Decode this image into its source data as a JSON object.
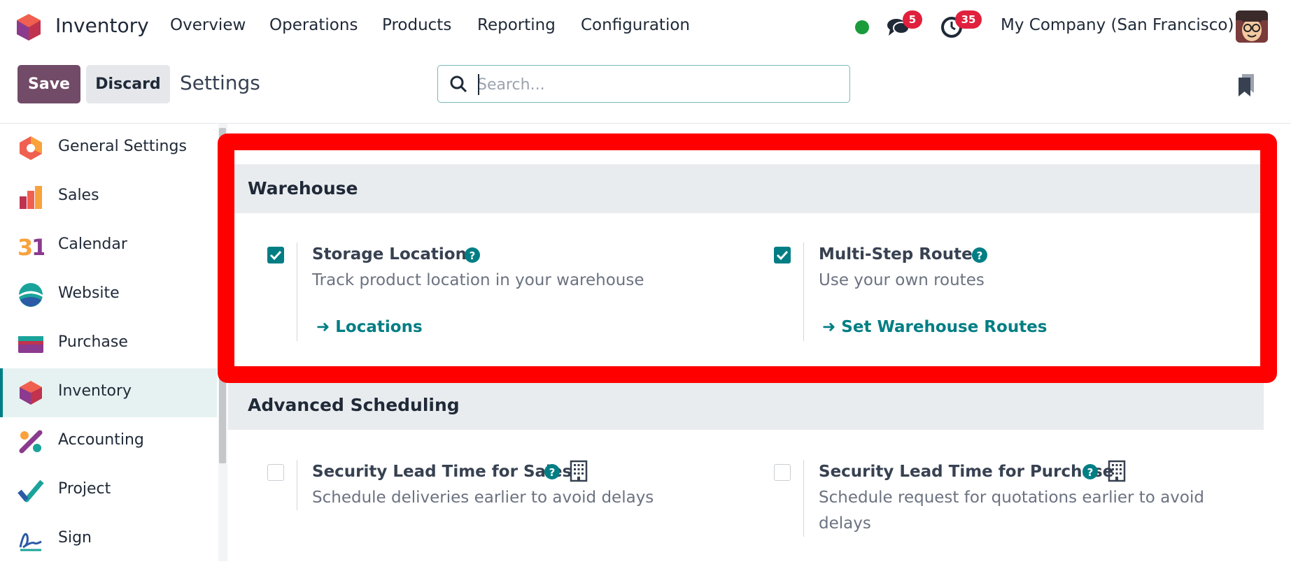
{
  "app": {
    "name": "Inventory",
    "menu": [
      "Overview",
      "Operations",
      "Products",
      "Reporting",
      "Configuration"
    ],
    "messages_count": "5",
    "activities_count": "35",
    "company": "My Company (San Francisco)",
    "presence_color": "#1a9c3c"
  },
  "control": {
    "save_label": "Save",
    "discard_label": "Discard",
    "breadcrumb": "Settings",
    "search_placeholder": "Search...",
    "search_value": ""
  },
  "sidebar": {
    "items": [
      {
        "label": "General Settings",
        "icon": "general-settings-icon"
      },
      {
        "label": "Sales",
        "icon": "sales-icon"
      },
      {
        "label": "Calendar",
        "icon": "calendar-icon"
      },
      {
        "label": "Website",
        "icon": "website-icon"
      },
      {
        "label": "Purchase",
        "icon": "purchase-icon"
      },
      {
        "label": "Inventory",
        "icon": "inventory-icon",
        "active": true
      },
      {
        "label": "Accounting",
        "icon": "accounting-icon"
      },
      {
        "label": "Project",
        "icon": "project-icon"
      },
      {
        "label": "Sign",
        "icon": "sign-icon"
      }
    ]
  },
  "sections": {
    "warehouse": {
      "title": "Warehouse",
      "settings": [
        {
          "title": "Storage Locations",
          "desc": "Track product location in your warehouse",
          "link": "Locations",
          "checked": true
        },
        {
          "title": "Multi-Step Routes",
          "desc": "Use your own routes",
          "link": "Set Warehouse Routes",
          "checked": true
        }
      ]
    },
    "advanced_scheduling": {
      "title": "Advanced Scheduling",
      "settings": [
        {
          "title": "Security Lead Time for Sales",
          "desc": "Schedule deliveries earlier to avoid delays",
          "checked": false
        },
        {
          "title": "Security Lead Time for Purchase",
          "desc_line1": "Schedule request for quotations earlier to avoid",
          "desc_line2": "delays",
          "checked": false
        }
      ]
    }
  },
  "colors": {
    "brand": "#714b67",
    "accent": "#017e84",
    "highlight": "#ff0000",
    "badge": "#e0203d"
  }
}
